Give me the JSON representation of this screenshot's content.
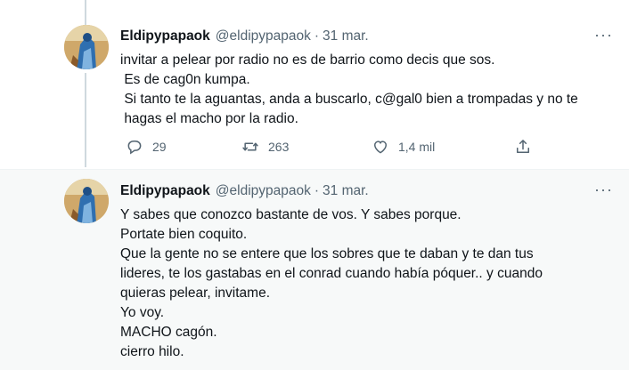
{
  "tweets": [
    {
      "name": "Eldipypapaok",
      "handle": "@eldipypapaok",
      "separator": "·",
      "date": "31 mar.",
      "more": "···",
      "text": "invitar a pelear por radio no es de barrio como decis que sos.\n Es de cag0n kumpa.\n Si tanto te la aguantas, anda a buscarlo, c@gal0 bien a trompadas y no te\n hagas el macho por la radio.",
      "replies": "29",
      "retweets": "263",
      "likes": "1,4 mil"
    },
    {
      "name": "Eldipypapaok",
      "handle": "@eldipypapaok",
      "separator": "·",
      "date": "31 mar.",
      "more": "···",
      "text": "Y sabes que conozco bastante de vos. Y sabes porque.\nPortate bien coquito.\nQue la gente no se entere que los sobres que te daban y te dan tus\nlideres, te los gastabas en el conrad cuando había póquer.. y cuando\nquieras pelear, invitame.\nYo voy.\nMACHO cagón.\ncierro hilo."
    }
  ],
  "icons": {
    "reply": "reply-icon",
    "retweet": "retweet-icon",
    "like": "heart-icon",
    "share": "share-icon"
  },
  "colors": {
    "text": "#0f1419",
    "secondary": "#536471",
    "highlight_bg": "#f7f9f9",
    "thread_line": "#cfd9de"
  }
}
